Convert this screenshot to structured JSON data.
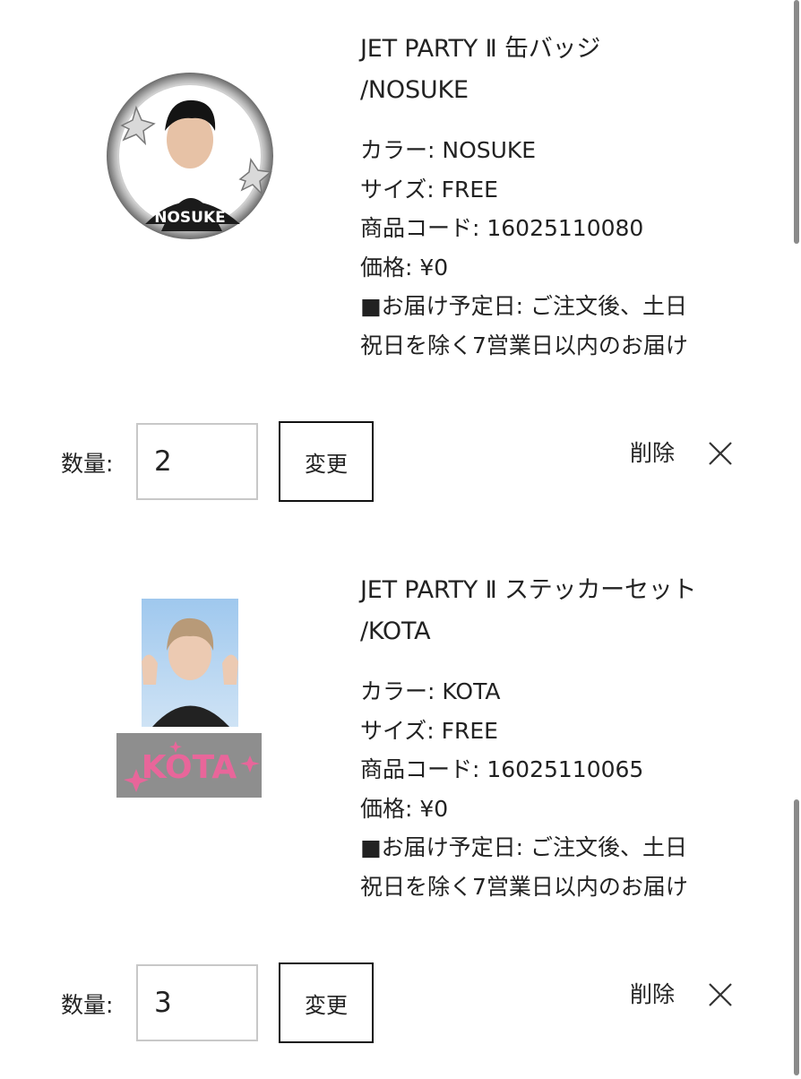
{
  "cart_items": [
    {
      "title_line1": "JET PARTY Ⅱ 缶バッジ",
      "title_line2": "/NOSUKE",
      "thumb_text": "NOSUKE",
      "details": [
        "カラー: NOSUKE",
        "サイズ: FREE",
        "商品コード: 16025110080",
        "価格: ¥0",
        "■お届け予定日: ご注文後、土日",
        "祝日を除く7営業日以内のお届け"
      ],
      "qty_label": "数量:",
      "quantity": "2",
      "change_label": "変更",
      "delete_label": "削除"
    },
    {
      "title_line1": "JET PARTY Ⅱ ステッカーセット",
      "title_line2": "/KOTA",
      "thumb_text": "KOTA",
      "details": [
        "カラー: KOTA",
        "サイズ: FREE",
        "商品コード: 16025110065",
        "価格: ¥0",
        "■お届け予定日: ご注文後、土日",
        "祝日を除く7営業日以内のお届け"
      ],
      "qty_label": "数量:",
      "quantity": "3",
      "change_label": "変更",
      "delete_label": "削除"
    }
  ],
  "icons": {
    "delete": "close-icon"
  },
  "colors": {
    "button_border": "#111111",
    "input_border": "#c8c8c8",
    "sticker_text": "#e8669a",
    "sticker_bg": "#8e8e8e"
  }
}
